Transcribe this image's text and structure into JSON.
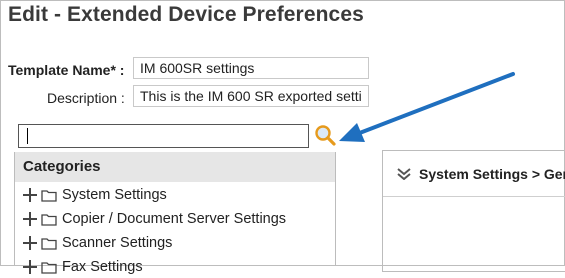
{
  "page": {
    "title": "Edit - Extended Device Preferences"
  },
  "form": {
    "template_name_label": "Template Name* :",
    "template_name_value": "IM 600SR settings",
    "description_label": "Description :",
    "description_value": "This is the IM 600 SR exported setti"
  },
  "search": {
    "value": "",
    "icon": "search-icon",
    "icon_color": "#e69a1c"
  },
  "annotation": {
    "arrow_color": "#1f6fbf"
  },
  "categories": {
    "header": "Categories",
    "items": [
      {
        "label": "System Settings"
      },
      {
        "label": "Copier / Document Server Settings"
      },
      {
        "label": "Scanner Settings"
      },
      {
        "label": "Fax Settings"
      }
    ]
  },
  "settings_panel": {
    "breadcrumb": "System Settings > Ger"
  }
}
